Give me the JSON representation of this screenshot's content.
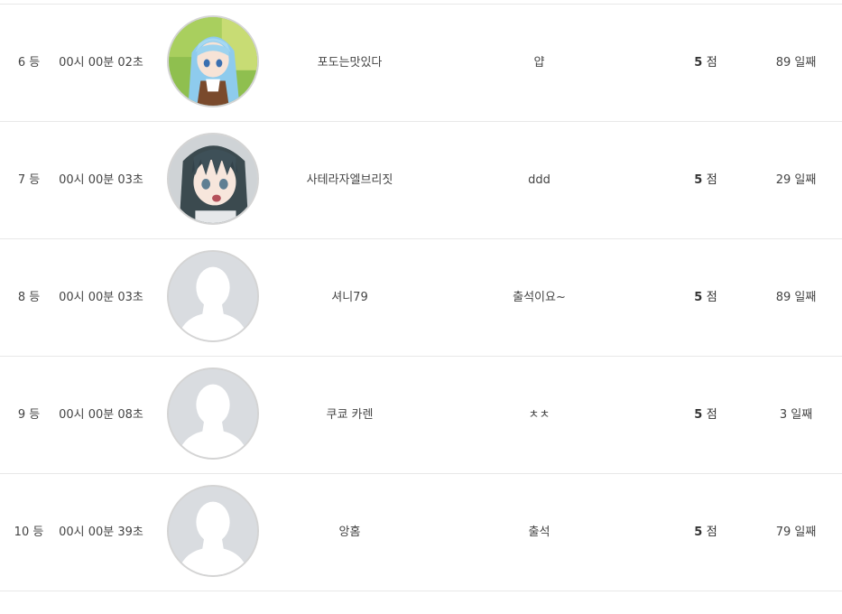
{
  "ranking": {
    "rows": [
      {
        "rank": "6 등",
        "time": "00시 00분 02초",
        "avatar": "anime-blue-hair-avatar-icon",
        "nickname": "포도는맛있다",
        "message": "얍",
        "points": "5",
        "points_unit": "점",
        "days": "89 일째"
      },
      {
        "rank": "7 등",
        "time": "00시 00분 03초",
        "avatar": "anime-dark-hair-avatar-icon",
        "nickname": "사테라자엘브리짓",
        "message": "ddd",
        "points": "5",
        "points_unit": "점",
        "days": "29 일째"
      },
      {
        "rank": "8 등",
        "time": "00시 00분 03초",
        "avatar": "default-user-avatar-icon",
        "nickname": "셔니79",
        "message": "출석이요~",
        "points": "5",
        "points_unit": "점",
        "days": "89 일째"
      },
      {
        "rank": "9 등",
        "time": "00시 00분 08초",
        "avatar": "default-user-avatar-icon",
        "nickname": "쿠쿄 카렌",
        "message": "ㅊㅊ",
        "points": "5",
        "points_unit": "점",
        "days": "3 일째"
      },
      {
        "rank": "10 등",
        "time": "00시 00분 39초",
        "avatar": "default-user-avatar-icon",
        "nickname": "앙홈",
        "message": "출석",
        "points": "5",
        "points_unit": "점",
        "days": "79 일째"
      }
    ]
  },
  "colors": {
    "divider": "#e8e8e8",
    "text": "#444444",
    "avatar_border": "#d4d4d4",
    "avatar_placeholder_bg": "#d9dce0",
    "avatar_placeholder_fg": "#ffffff"
  }
}
